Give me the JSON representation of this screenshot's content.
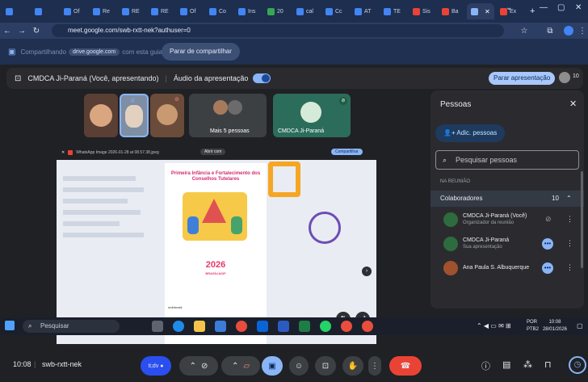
{
  "browser": {
    "tabs": [
      {
        "label": "",
        "color": "#4285f4"
      },
      {
        "label": "",
        "color": "#4285f4"
      },
      {
        "label": "Of",
        "color": "#4285f4"
      },
      {
        "label": "Re",
        "color": "#4285f4"
      },
      {
        "label": "RE",
        "color": "#4285f4"
      },
      {
        "label": "RE",
        "color": "#4285f4"
      },
      {
        "label": "Of",
        "color": "#4285f4"
      },
      {
        "label": "Co",
        "color": "#4285f4"
      },
      {
        "label": "Ins",
        "color": "#4285f4"
      },
      {
        "label": "20",
        "color": "#34a853"
      },
      {
        "label": "cal",
        "color": "#4285f4"
      },
      {
        "label": "Cc",
        "color": "#4285f4"
      },
      {
        "label": "AT",
        "color": "#4285f4"
      },
      {
        "label": "TE",
        "color": "#4285f4"
      },
      {
        "label": "Sis",
        "color": "#ea4335"
      },
      {
        "label": "Ba",
        "color": "#ea4335"
      },
      {
        "label": "",
        "color": "#8ab4f8",
        "active": true
      },
      {
        "label": "Ex",
        "color": "#ea4335"
      }
    ],
    "url": "meet.google.com/swb-rxtt-nek?authuser=0"
  },
  "sharebar": {
    "text_pre": "Compartilhando",
    "chip": "drive.google.com",
    "text_post": "com esta guia",
    "stop_label": "Parar de compartilhar"
  },
  "meet": {
    "presenting_label": "CMDCA Ji-Paraná (Você, apresentando)",
    "audio_label": "Áudio da apresentação",
    "stop_presentation": "Parar apresentação",
    "participant_count": "10",
    "more_people": "Mais 5 pessoas",
    "self_tile_name": "CMDCA Ji-Paraná",
    "time": "10:08",
    "meeting_code": "swb-rxtt-nek",
    "shared": {
      "file_name": "WhatsApp Image 2026-01-28 at 08.57.38.jpeg",
      "open_with": "Abrir com",
      "share_btn": "Compartilhar",
      "poster_title": "Primeira Infância e Fortalecimento dos Conselhos Tutelares",
      "poster_year": "2026",
      "poster_city": "BRASÍLIA/DF",
      "poster_footer": "mdhbrasil"
    }
  },
  "panel": {
    "title": "Pessoas",
    "add_label": "Adic. pessoas",
    "search_placeholder": "Pesquisar pessoas",
    "section": "NA REUNIÃO",
    "group": "Colaboradores",
    "group_count": "10",
    "people": [
      {
        "name": "CMDCA Ji-Paraná (Você)",
        "sub": "Organizador da reunião"
      },
      {
        "name": "CMDCA Ji-Paraná",
        "sub": "Sua apresentação"
      },
      {
        "name": "Ana Paula S. Albuquerque",
        "sub": ""
      }
    ]
  },
  "taskbar": {
    "search": "Pesquisar",
    "lang": "POR",
    "lang2": "PTB2",
    "clock": "10:08",
    "date": "28/01/2026"
  }
}
